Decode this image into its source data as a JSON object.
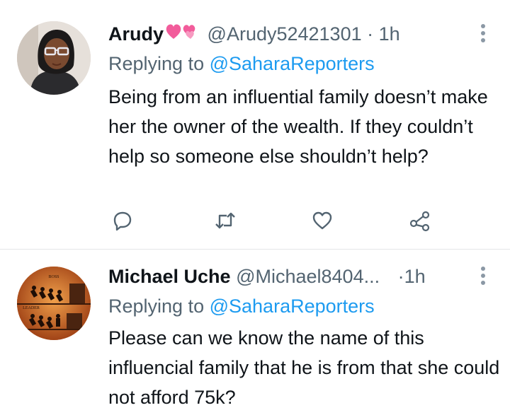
{
  "tweets": [
    {
      "name": "Arudy",
      "emoji": "💕💕",
      "handle": "@Arudy52421301",
      "separator": "·",
      "time": "1h",
      "replying_prefix": "Replying to",
      "replying_to": "@SaharaReporters",
      "body": "Being from an influential family doesn’t make her the owner of the wealth. If they couldn’t help so someone else shouldn’t help?"
    },
    {
      "name": "Michael Uche",
      "handle": "@Michael8404...",
      "separator": "·",
      "time": "1h",
      "replying_prefix": "Replying to",
      "replying_to": "@SaharaReporters",
      "body": "Please can we know the name of this influencial family that he is from that she could not afford 75k?",
      "avatar_labels": {
        "top": "BOSS",
        "bottom": "LEADER"
      }
    }
  ],
  "icons": [
    "reply-icon",
    "retweet-icon",
    "like-icon",
    "share-icon",
    "more-icon"
  ],
  "colors": {
    "text": "#0f1419",
    "secondary": "#536471",
    "link": "#1d9bf0",
    "heart_emoji": "#f25c9b"
  }
}
